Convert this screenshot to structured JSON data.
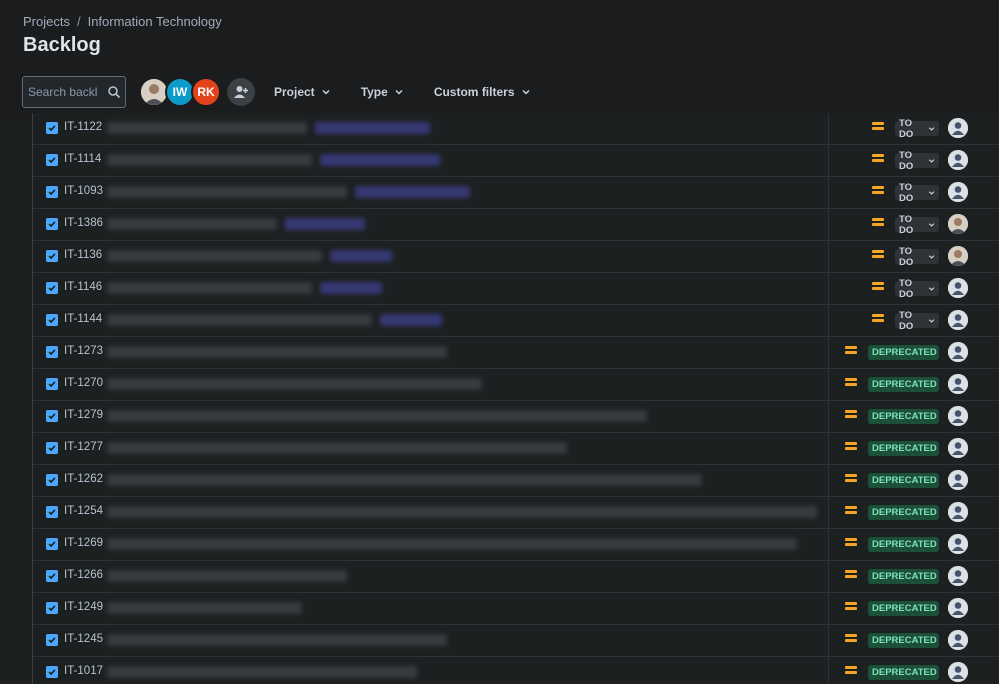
{
  "breadcrumb": {
    "projects": "Projects",
    "separator": "/",
    "current": "Information Technology"
  },
  "page_title": "Backlog",
  "search": {
    "placeholder": "Search backlog"
  },
  "avatars": [
    {
      "kind": "photo",
      "initials": ""
    },
    {
      "kind": "initials",
      "initials": "IW",
      "color": "#0c9ac9"
    },
    {
      "kind": "initials",
      "initials": "RK",
      "color": "#e3431b"
    }
  ],
  "filters": {
    "project": "Project",
    "type": "Type",
    "custom": "Custom filters"
  },
  "colors": {
    "todo_bg": "#2f3338",
    "deprecated_bg": "#1c4f3a",
    "priority_medium": "#f5a623",
    "checkbox": "#4aa8ff"
  },
  "rows": [
    {
      "key": "IT-1122",
      "status": "TO DO",
      "assignee": "unassigned"
    },
    {
      "key": "IT-1114",
      "status": "TO DO",
      "assignee": "unassigned"
    },
    {
      "key": "IT-1093",
      "status": "TO DO",
      "assignee": "unassigned"
    },
    {
      "key": "IT-1386",
      "status": "TO DO",
      "assignee": "photo"
    },
    {
      "key": "IT-1136",
      "status": "TO DO",
      "assignee": "photo"
    },
    {
      "key": "IT-1146",
      "status": "TO DO",
      "assignee": "unassigned"
    },
    {
      "key": "IT-1144",
      "status": "TO DO",
      "assignee": "unassigned"
    },
    {
      "key": "IT-1273",
      "status": "DEPRECATED",
      "assignee": "unassigned"
    },
    {
      "key": "IT-1270",
      "status": "DEPRECATED",
      "assignee": "unassigned"
    },
    {
      "key": "IT-1279",
      "status": "DEPRECATED",
      "assignee": "unassigned"
    },
    {
      "key": "IT-1277",
      "status": "DEPRECATED",
      "assignee": "unassigned"
    },
    {
      "key": "IT-1262",
      "status": "DEPRECATED",
      "assignee": "unassigned"
    },
    {
      "key": "IT-1254",
      "status": "DEPRECATED",
      "assignee": "unassigned"
    },
    {
      "key": "IT-1269",
      "status": "DEPRECATED",
      "assignee": "unassigned"
    },
    {
      "key": "IT-1266",
      "status": "DEPRECATED",
      "assignee": "unassigned"
    },
    {
      "key": "IT-1249",
      "status": "DEPRECATED",
      "assignee": "unassigned"
    },
    {
      "key": "IT-1245",
      "status": "DEPRECATED",
      "assignee": "unassigned"
    },
    {
      "key": "IT-1017",
      "status": "DEPRECATED",
      "assignee": "unassigned"
    }
  ]
}
